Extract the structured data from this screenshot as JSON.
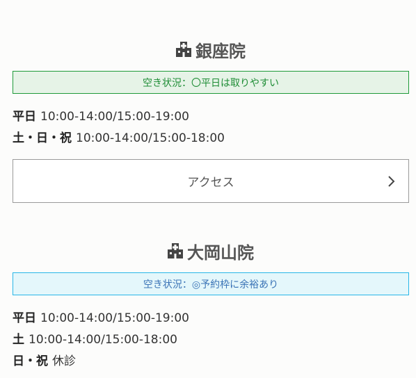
{
  "clinics": [
    {
      "name": "銀座院",
      "icon": "hospital-icon",
      "vacancy": "空き状況：〇平日は取りやすい",
      "vacancy_color": "#1f9a39",
      "hours": [
        {
          "label": "平日",
          "time": "10:00-14:00/15:00-19:00"
        },
        {
          "label": "土・日・祝",
          "time": "10:00-14:00/15:00-18:00"
        }
      ],
      "access_label": "アクセス"
    },
    {
      "name": "大岡山院",
      "icon": "hospital-icon",
      "vacancy": "空き状況：◎予約枠に余裕あり",
      "vacancy_color": "#27b6e8",
      "hours": [
        {
          "label": "平日",
          "time": "10:00-14:00/15:00-19:00"
        },
        {
          "label": "土",
          "time": "10:00-14:00/15:00-18:00"
        },
        {
          "label": "日・祝",
          "time": "休診"
        }
      ]
    }
  ]
}
